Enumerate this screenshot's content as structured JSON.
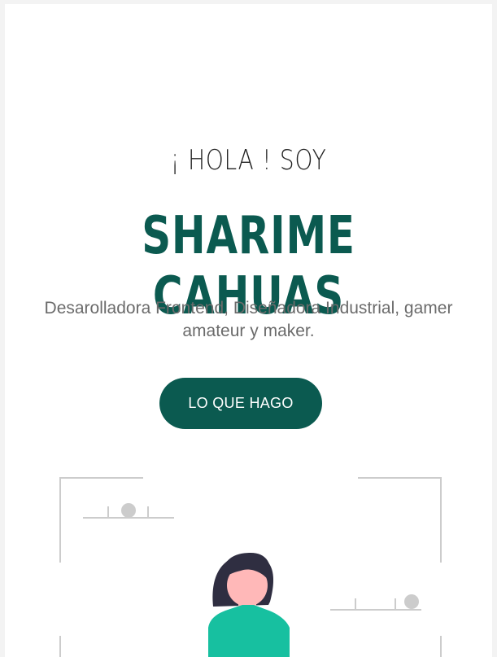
{
  "hero": {
    "greeting": "¡ HOLA ! SOY",
    "name": "SHARIME CAHUAS",
    "tagline": "Desarolladora Frontend, Diseñadora Industrial, gamer amateur y maker.",
    "cta_label": "LO QUE HAGO"
  },
  "colors": {
    "brand": "#0b5a50",
    "text_muted": "#6b6b6b",
    "figure_shirt": "#17c0a0",
    "figure_skin": "#ffb8b8",
    "figure_hair": "#2f2e41",
    "line_gray": "#cccccc"
  }
}
